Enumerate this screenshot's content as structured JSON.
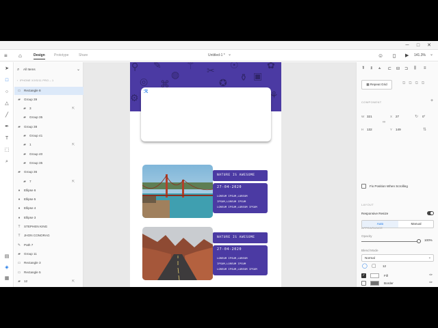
{
  "window": {
    "minimize": "─",
    "maximize": "□",
    "close": "✕"
  },
  "topbar": {
    "menu_icon": "≡",
    "home_icon": "⌂",
    "tabs": [
      "Design",
      "Prototype",
      "Share"
    ],
    "doc_title": "Untitled-1 *",
    "doc_chevron": "⌄",
    "user_icon": "☺",
    "device_icon": "▯",
    "play_icon": "▶",
    "zoom": "141.3%",
    "zoom_chevron": "⌄"
  },
  "tools": [
    "select-icon",
    "rectangle-icon",
    "ellipse-icon",
    "triangle-icon",
    "line-icon",
    "pen-icon",
    "text-icon",
    "artboard-icon",
    "zoom-icon"
  ],
  "tool_glyphs": [
    "➤",
    "□",
    "○",
    "△",
    "╱",
    "✒",
    "T",
    "⬚",
    "⌕"
  ],
  "tools_bottom_glyphs": [
    "▤",
    "◈",
    "▦"
  ],
  "layers": {
    "filter_label": "All Items",
    "crumb": "IPHONE X/XS/11 PRO – 1",
    "items": [
      {
        "name": "Rectangle 8",
        "icon": "▭"
      },
      {
        "name": "Group 39",
        "icon": "▰"
      },
      {
        "name": "3",
        "icon": "▰"
      },
      {
        "name": "Group 35",
        "icon": "▰"
      },
      {
        "name": "Group 38",
        "icon": "▰"
      },
      {
        "name": "Group 41",
        "icon": "▰"
      },
      {
        "name": "1",
        "icon": "▰"
      },
      {
        "name": "Group 40",
        "icon": "▰"
      },
      {
        "name": "Group 35",
        "icon": "▰"
      },
      {
        "name": "Group 36",
        "icon": "▰"
      },
      {
        "name": "7",
        "icon": "▰"
      },
      {
        "name": "Ellipse 6",
        "icon": "●"
      },
      {
        "name": "Ellipse 5",
        "icon": "●"
      },
      {
        "name": "Ellipse 4",
        "icon": "●"
      },
      {
        "name": "Ellipse 3",
        "icon": "●"
      },
      {
        "name": "STEPHEN KING",
        "icon": "T"
      },
      {
        "name": "JHON CONORAG",
        "icon": "T"
      },
      {
        "name": "Path 7",
        "icon": "✎"
      },
      {
        "name": "Group 11",
        "icon": "▰"
      },
      {
        "name": "Rectangle 3",
        "icon": "▭"
      },
      {
        "name": "Rectangle 5",
        "icon": "▭"
      },
      {
        "name": "12",
        "icon": "▰"
      }
    ]
  },
  "canvas": {
    "card1": {
      "tag": "NATURE IS AWESOME",
      "date": "27-04-2020",
      "lines": [
        "LOREUM IPSUM,LOREUM",
        "IPSUM,LOREUM IPSUM",
        "LOREUM IPSUM,LOREUM IPSUM"
      ]
    },
    "card2": {
      "tag": "NATURE IS AWESOME",
      "date": "27-04-2020",
      "lines": [
        "LOREUM IPSUM,LOREUM",
        "IPSUM,LOREUM IPSUM",
        "LOREUM IPSUM,LOREUM IPSUM"
      ]
    }
  },
  "props": {
    "repeat_grid": "Repeat Grid",
    "component_label": "COMPONENT",
    "w_label": "W",
    "w": "321",
    "h_label": "H",
    "h": "132",
    "x_label": "X",
    "x": "27",
    "y_label": "Y",
    "y": "149",
    "rotation": "0°",
    "fix_scroll": "Fix Position When Scrolling",
    "layout_label": "LAYOUT",
    "responsive_resize": "Responsive Resize",
    "auto": "Auto",
    "manual": "Manual",
    "appearance_label": "APPEARANCE",
    "opacity_label": "Opacity",
    "opacity": "100%",
    "opacity_fraction": 1.0,
    "blend_label": "Blend Mode",
    "blend": "Normal",
    "radius": "12",
    "fill_label": "Fill",
    "border_label": "Border",
    "fill_color": "#ffffff",
    "border_color": "#707070"
  },
  "colors": {
    "accent": "#4b3aa3",
    "selection": "#1473e6"
  }
}
